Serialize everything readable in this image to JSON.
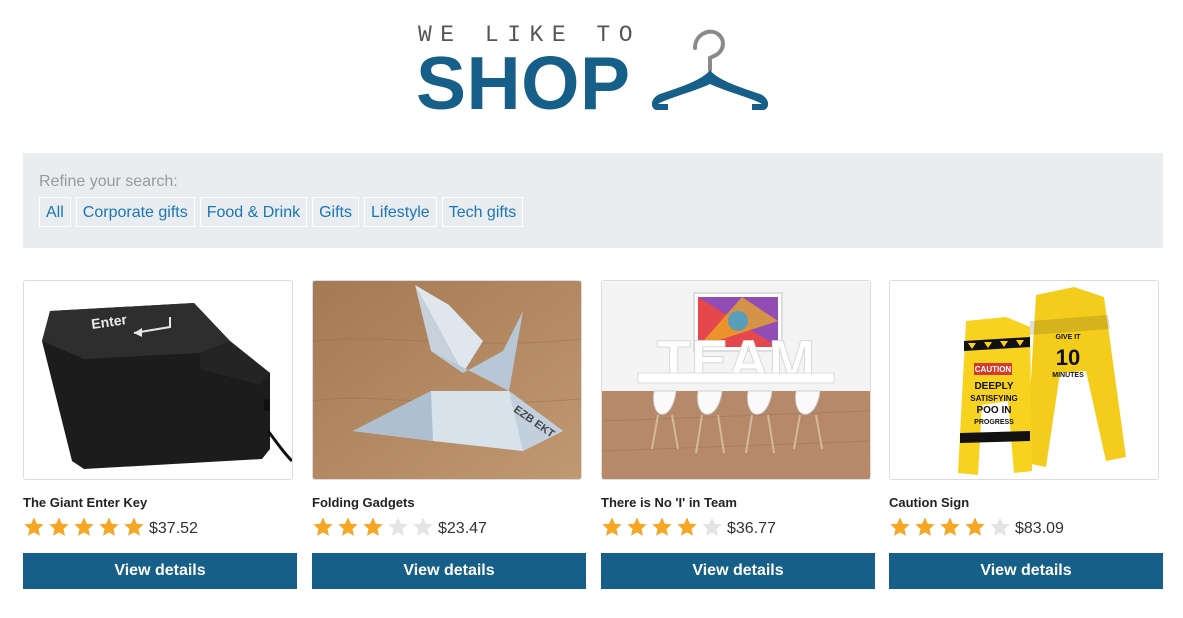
{
  "logo": {
    "line1": "WE LIKE TO",
    "line2": "SHOP"
  },
  "filter": {
    "label": "Refine your search:",
    "categories": [
      "All",
      "Corporate gifts",
      "Food & Drink",
      "Gifts",
      "Lifestyle",
      "Tech gifts"
    ]
  },
  "products": [
    {
      "title": "The Giant Enter Key",
      "rating": 5,
      "price": "$37.52",
      "button": "View details",
      "image": "enter-key-image"
    },
    {
      "title": "Folding Gadgets",
      "rating": 3,
      "price": "$23.47",
      "button": "View details",
      "image": "origami-bird-image"
    },
    {
      "title": "There is No 'I' in Team",
      "rating": 4,
      "price": "$36.77",
      "button": "View details",
      "image": "team-room-image",
      "image_text": "TEAM"
    },
    {
      "title": "Caution Sign",
      "rating": 4,
      "price": "$83.09",
      "button": "View details",
      "image": "caution-sign-image",
      "image_text": [
        "CAUTION",
        "DEEPLY",
        "SATISFYING",
        "POO IN",
        "PROGRESS",
        "GIVE IT",
        "10",
        "MINUTES"
      ]
    }
  ],
  "colors": {
    "brand": "#155f88",
    "link": "#1a76b5",
    "panel": "#e9edf0",
    "star_on": "#f5a623",
    "star_off": "#e4e4e4"
  },
  "icons": {
    "hanger": "hanger-icon",
    "star": "star-icon"
  }
}
